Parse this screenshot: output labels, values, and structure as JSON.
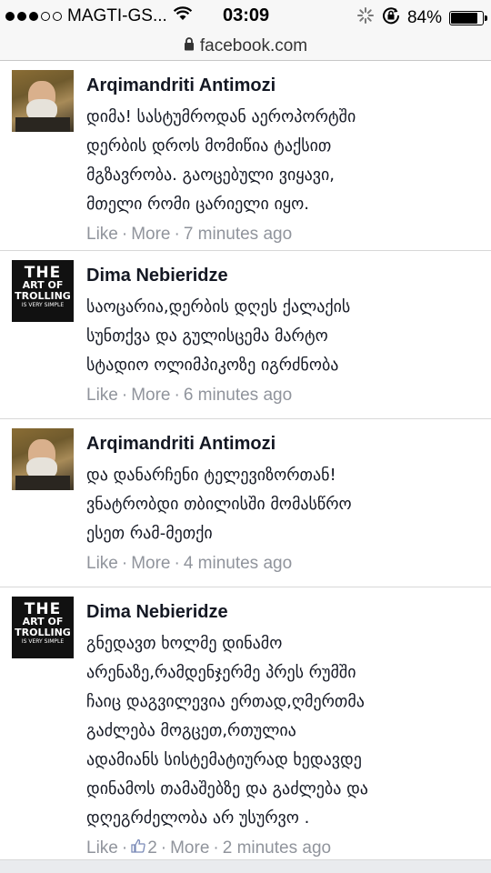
{
  "status_bar": {
    "carrier": "MAGTI-GS...",
    "time": "03:09",
    "battery_percent_label": "84%",
    "battery_level": 0.84
  },
  "url_bar": {
    "url": "facebook.com"
  },
  "comments": [
    {
      "author": "Arqimandriti Antimozi",
      "avatar": "photo-portrait",
      "lines": [
        "დიმა! სასტუმროდან აეროპორტში",
        "დერბის დროს მომიწია ტაქსით",
        "მგზავრობა. გაოცებული ვიყავი,",
        "მთელი რომი ცარიელი იყო."
      ],
      "like": "Like",
      "more": "More",
      "time": "7 minutes ago"
    },
    {
      "author": "Dima Nebieridze",
      "avatar": "art-of-trolling",
      "avatar_text": [
        "THE",
        "ART OF",
        "TROLLING",
        "IS VERY SIMPLE"
      ],
      "lines": [
        "საოცარია,დერბის დღეს ქალაქის",
        "სუნთქვა და გულისცემა მარტო",
        "სტადიო ოლიმპიკოზე იგრძნობა"
      ],
      "like": "Like",
      "more": "More",
      "time": "6 minutes ago"
    },
    {
      "author": "Arqimandriti Antimozi",
      "avatar": "photo-portrait",
      "lines": [
        "და დანარჩენი ტელევიზორთან!",
        "ვნატრობდი თბილისში მომასწრო",
        "ესეთ რამ-მეთქი"
      ],
      "like": "Like",
      "more": "More",
      "time": "4 minutes ago"
    },
    {
      "author": "Dima Nebieridze",
      "avatar": "art-of-trolling",
      "avatar_text": [
        "THE",
        "ART OF",
        "TROLLING",
        "IS VERY SIMPLE"
      ],
      "lines": [
        "გნედავთ ხოლმე დინამო",
        "არენაზე,რამდენჯერმე პრეს რუმში",
        "ჩაიც დაგვილევია ერთად,ღმერთმა",
        "გაძლება მოგცეთ,რთულია",
        "ადამიანს სისტემატიურად ხედავდე",
        "დინამოს თამაშებზე და გაძლება და",
        "დღეგრძელობა არ უსურვო ."
      ],
      "like": "Like",
      "like_count": "2",
      "more": "More",
      "time": "2 minutes ago"
    }
  ]
}
